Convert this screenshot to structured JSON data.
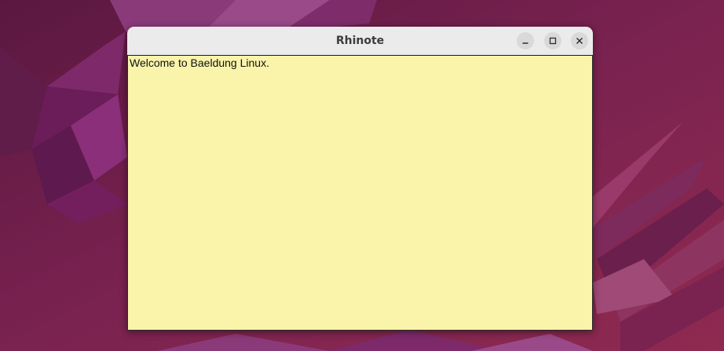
{
  "window": {
    "title": "Rhinote",
    "controls": {
      "minimize": "minimize-icon",
      "maximize": "maximize-icon",
      "close": "close-icon"
    }
  },
  "note": {
    "text": "Welcome to Baeldung Linux."
  },
  "colors": {
    "desktop_background": "#6e1f4c",
    "note_background": "#f9f4aa",
    "titlebar": "#ebebeb"
  }
}
